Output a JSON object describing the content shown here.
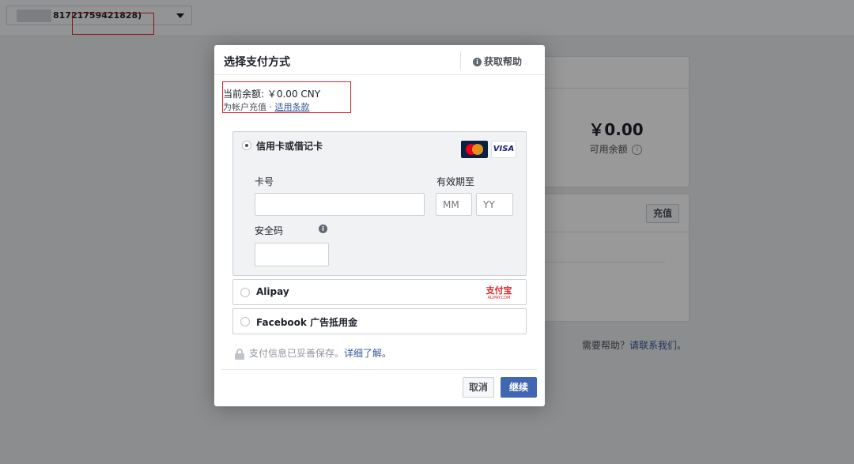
{
  "topbar": {
    "account_id": "81721759421828)"
  },
  "background": {
    "balance_amount": "￥0.00",
    "balance_label": "可用余额",
    "info_glyph": "i",
    "recharge_button": "充值",
    "help_text": "需要帮助？",
    "help_link": "请联系我们",
    "help_suffix": "。"
  },
  "modal": {
    "title": "选择支付方式",
    "help_button": "获取帮助",
    "help_glyph": "i",
    "balance": {
      "current": "当前余额:  ￥0.00 CNY",
      "recharge_prefix": "为帐户充值 · ",
      "terms_link": "适用条款"
    },
    "card": {
      "label": "信用卡或借记卡",
      "visa": "VISA",
      "card_number_label": "卡号",
      "expiry_label": "有效期至",
      "mm_placeholder": "MM",
      "yy_placeholder": "YY",
      "cvv_label": "安全码",
      "cvv_glyph": "i"
    },
    "alipay": {
      "label": "Alipay",
      "logo_cn": "支付宝",
      "logo_en": "ALIPAY.COM"
    },
    "fb_credit": {
      "label": "Facebook 广告抵用金"
    },
    "secure": {
      "text": "支付信息已妥善保存。",
      "link": "详细了解。"
    },
    "buttons": {
      "cancel": "取消",
      "continue": "继续"
    }
  },
  "colors": {
    "accent": "#4267b2",
    "link": "#365899",
    "annotation": "#e0252b"
  }
}
